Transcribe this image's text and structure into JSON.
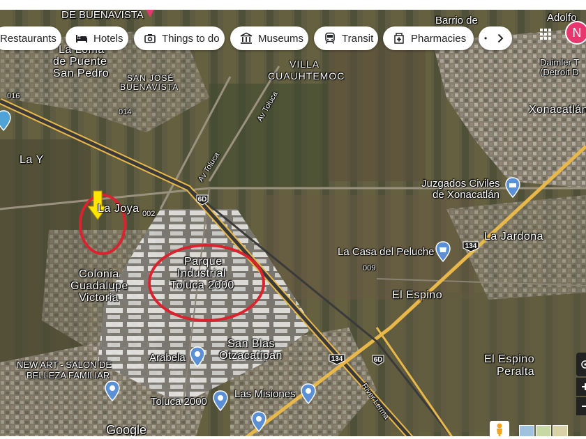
{
  "chips": [
    {
      "label": "Restaurants",
      "icon": "restaurant-icon"
    },
    {
      "label": "Hotels",
      "icon": "bed-icon"
    },
    {
      "label": "Things to do",
      "icon": "camera-icon"
    },
    {
      "label": "Museums",
      "icon": "museum-icon"
    },
    {
      "label": "Transit",
      "icon": "train-icon"
    },
    {
      "label": "Pharmacies",
      "icon": "pharmacy-icon"
    }
  ],
  "account": {
    "initial": "N",
    "color": "#e8366f"
  },
  "places": {
    "de_buenavista": "DE BUENAVISTA",
    "barrio_de": "Barrio de",
    "adolfo": "Adolfo",
    "la_loma_1": "La Loma",
    "la_loma_2": "de Puente",
    "la_loma_3": "San Pedro",
    "villa_1": "VILLA",
    "villa_2": "CUAUHTEMOC",
    "san_jose_1": "SAN JOSÉ",
    "san_jose_2": "BUENAVISTA",
    "daimler_1": "Daimler T",
    "daimler_2": "(Detroit D",
    "xonacatlan": "Xonacatlán",
    "la_y": "La Y",
    "juzgados_1": "Juzgados Civiles",
    "juzgados_2": "de Xonacatlán",
    "la_joya": "La Joya",
    "la_jardona": "La Jardona",
    "parque_1": "Parque",
    "parque_2": "Industrial",
    "parque_3": "Toluca 2000",
    "la_casa": "La Casa del Peluche",
    "colonia_1": "Colonia",
    "colonia_2": "Guadalupe",
    "colonia_3": "Victoria",
    "el_espino": "El Espino",
    "san_blas_1": "San Blas",
    "san_blas_2": "Otzacatipan",
    "arabela": "Arabela",
    "new_art_1": "NEW ART - SALON DE",
    "new_art_2": "BELLEZA FAMILIAR",
    "el_espino_peralta_1": "El Espino",
    "el_espino_peralta_2": "Peralta",
    "toluca_2000": "Toluca 2000",
    "las_misiones": "Las Misiones",
    "google": "Google"
  },
  "roads": {
    "r016": "016",
    "r014": "014",
    "r002": "002",
    "r009": "009",
    "av_toluca_1": "Av Toluca",
    "av_toluca_2": "Av Toluca",
    "river_lerma": "River Lerma",
    "shield_6d_1": "6D",
    "shield_6d_2": "6D",
    "shield_134_1": "134",
    "shield_134_2": "134"
  },
  "colors": {
    "highway": "#e9b84a",
    "highway_dark": "#3a3a3a",
    "annotation_ellipse": "#d9232f",
    "arrow": "#ffe600",
    "pin": "#5b8fd6",
    "pin_pink": "#e8366f"
  }
}
